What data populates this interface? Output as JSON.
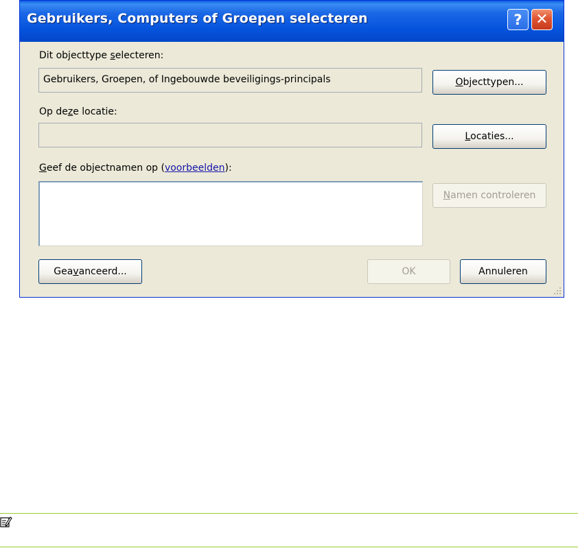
{
  "window": {
    "title": "Gebruikers, Computers of Groepen selecteren",
    "help_glyph": "?",
    "close_glyph": "✕"
  },
  "objecttype": {
    "label_before": "Dit objecttype ",
    "label_accel": "s",
    "label_after": "electeren:",
    "value": "Gebruikers, Groepen, of Ingebouwde beveiligings-principals",
    "button_accel": "O",
    "button_rest": "bjecttypen..."
  },
  "location": {
    "label_before": "Op de",
    "label_accel": "z",
    "label_after": "e locatie:",
    "value": "",
    "button_accel": "L",
    "button_rest": "ocaties..."
  },
  "objectnames": {
    "label_accel": "G",
    "label_before": "eef de objectnamen op (",
    "link": "voorbeelden",
    "label_after": "):",
    "value": "",
    "check_button_accel": "N",
    "check_button_rest": "amen controleren"
  },
  "footer": {
    "advanced_before": "Gea",
    "advanced_accel": "v",
    "advanced_after": "anceerd...",
    "ok_label": "OK",
    "cancel_label": "Annuleren"
  },
  "colors": {
    "titlebar": "#0553dc",
    "dialog_bg": "#ece9d8",
    "link": "#1515a8",
    "note_rule": "#9acd32"
  },
  "icons": {
    "note": "note-pencil-icon",
    "grip": "resize-grip-icon"
  }
}
